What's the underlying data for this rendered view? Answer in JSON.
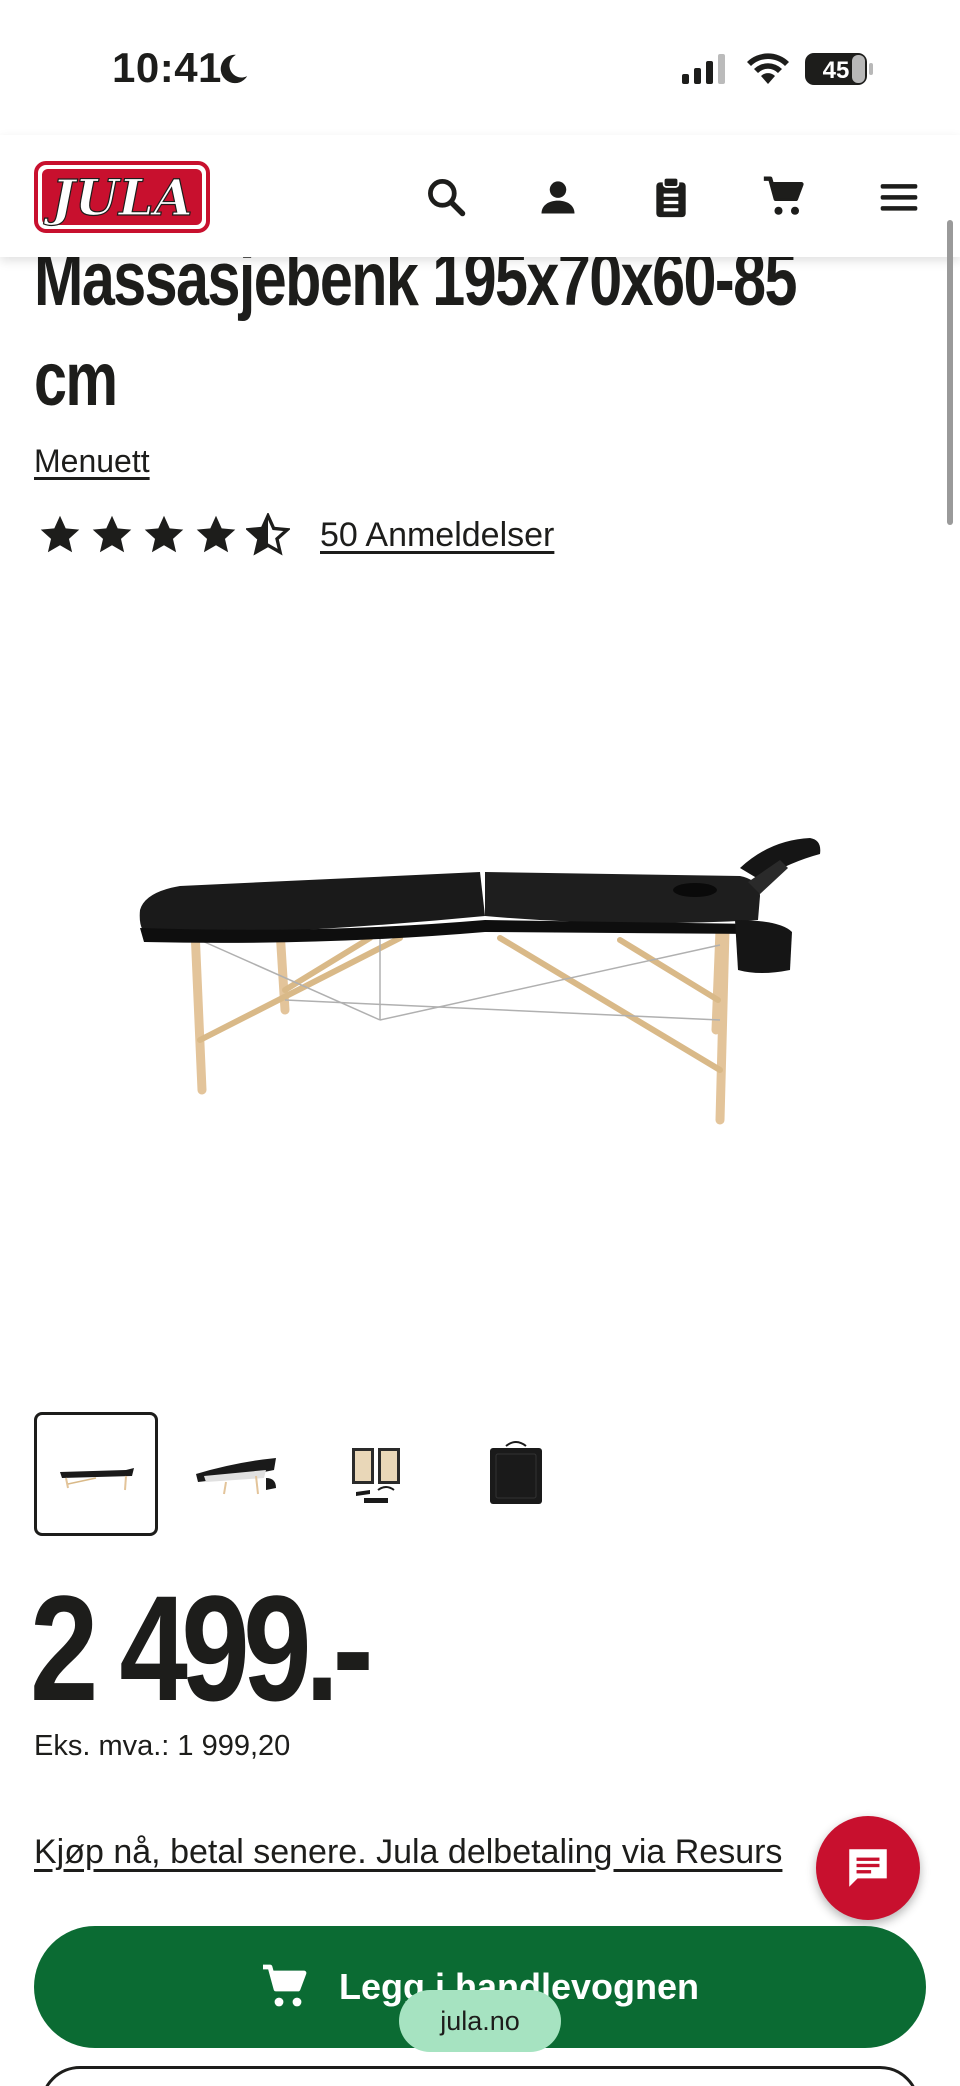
{
  "status_bar": {
    "time": "10:41",
    "battery": "45"
  },
  "header": {
    "logo_text": "JULA",
    "icons": [
      "search-icon",
      "account-icon",
      "clipboard-icon",
      "cart-icon",
      "menu-icon"
    ]
  },
  "product": {
    "title_line1": "Massasjebenk 195x70x60-85",
    "title_line2": "cm",
    "brand": "Menuett",
    "rating": 4.5,
    "reviews_label": "50 Anmeldelser",
    "price": "2 499.-",
    "ex_vat": "Eks. mva.: 1 999,20",
    "installment_link": "Kjøp nå, betal senere. Jula delbetaling via Resurs",
    "add_to_cart_label": "Legg i handlevognen",
    "thumbnails": [
      "thumbnail-1",
      "thumbnail-2",
      "thumbnail-3",
      "thumbnail-4"
    ]
  },
  "browser": {
    "url": "jula.no"
  },
  "colors": {
    "brand_red": "#c8102e",
    "cart_green": "#0b6b33",
    "text": "#1d1d1b"
  }
}
